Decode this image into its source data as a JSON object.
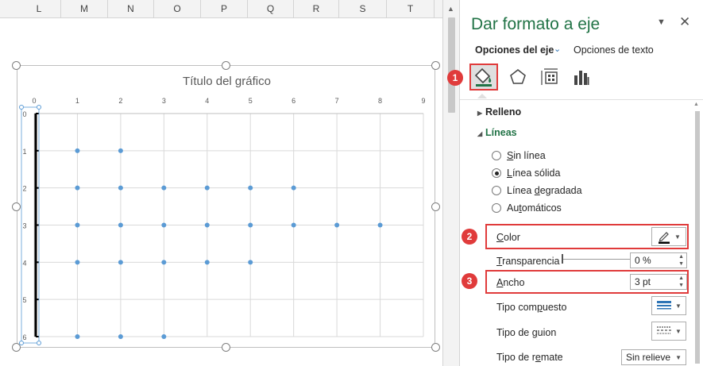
{
  "columns": [
    "L",
    "M",
    "N",
    "O",
    "P",
    "Q",
    "R",
    "S",
    "T"
  ],
  "chart_data": {
    "type": "scatter",
    "title": "Título del gráfico",
    "xlabel": "",
    "ylabel": "",
    "x_ticks": [
      "0",
      "1",
      "2",
      "3",
      "4",
      "5",
      "6",
      "7",
      "8",
      "9"
    ],
    "y_ticks": [
      "0",
      "1",
      "2",
      "3",
      "4",
      "5",
      "6"
    ],
    "xlim": [
      0,
      9
    ],
    "ylim": [
      0,
      6
    ],
    "y_reversed": true,
    "x_axis_position": "top",
    "grid": true,
    "point_color": "#5b9bd5",
    "series": [
      {
        "points": [
          [
            1,
            1
          ],
          [
            2,
            1
          ],
          [
            1,
            2
          ],
          [
            2,
            2
          ],
          [
            3,
            2
          ],
          [
            4,
            2
          ],
          [
            5,
            2
          ],
          [
            6,
            2
          ],
          [
            1,
            3
          ],
          [
            2,
            3
          ],
          [
            3,
            3
          ],
          [
            4,
            3
          ],
          [
            5,
            3
          ],
          [
            6,
            3
          ],
          [
            7,
            3
          ],
          [
            8,
            3
          ],
          [
            1,
            4
          ],
          [
            2,
            4
          ],
          [
            3,
            4
          ],
          [
            4,
            4
          ],
          [
            5,
            4
          ],
          [
            1,
            6
          ],
          [
            2,
            6
          ],
          [
            3,
            6
          ]
        ]
      }
    ]
  },
  "pane": {
    "title": "Dar formato a eje",
    "dropdown_icon": "chevron-down-icon",
    "close_icon": "close-icon",
    "tabs": {
      "axis_options": "Opciones del eje",
      "text_options": "Opciones de texto"
    },
    "icons": [
      "fill-line-icon",
      "effects-icon",
      "size-properties-icon",
      "axis-options-icon"
    ],
    "sections": {
      "relleno": "Relleno",
      "lineas": "Líneas"
    },
    "line_options": {
      "sin_linea": "Sin línea",
      "linea_solida": "Línea sólida",
      "linea_degradada": "Línea degradada",
      "automaticos": "Automáticos",
      "selected": "Línea sólida"
    },
    "properties": {
      "color": "Color",
      "transparencia": "Transparencia",
      "transparencia_value": "0 %",
      "ancho": "Ancho",
      "ancho_value": "3 pt",
      "tipo_compuesto": "Tipo compuesto",
      "tipo_guion": "Tipo de guion",
      "tipo_remate": "Tipo de remate",
      "tipo_remate_value": "Sin relieve"
    },
    "badges": [
      "1",
      "2",
      "3"
    ],
    "accent_color": "#217346",
    "highlight_color": "#e03b3b"
  }
}
